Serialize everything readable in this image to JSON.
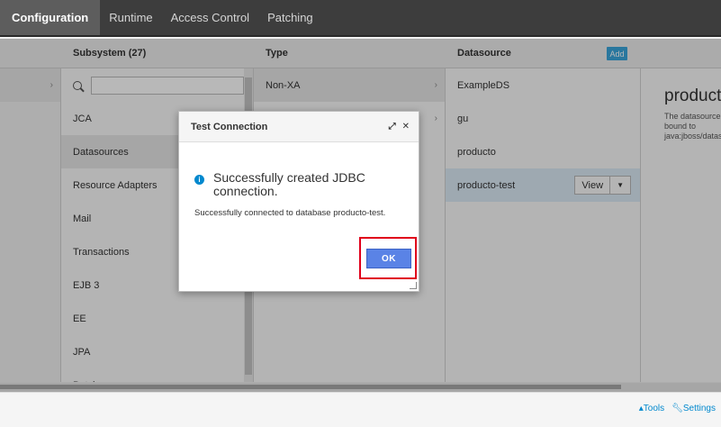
{
  "topnav": {
    "tabs": [
      "Configuration",
      "Runtime",
      "Access Control",
      "Patching"
    ]
  },
  "columns": {
    "subsystem": {
      "header": "Subsystem (27)",
      "items": [
        "JCA",
        "Datasources",
        "Resource Adapters",
        "Mail",
        "Transactions",
        "EJB 3",
        "EE",
        "JPA",
        "Batch"
      ]
    },
    "type": {
      "header": "Type",
      "items": [
        "Non-XA"
      ]
    },
    "datasource": {
      "header": "Datasource",
      "add_label": "Add",
      "items": [
        "ExampleDS",
        "gu",
        "producto",
        "producto-test"
      ],
      "view_label": "View"
    }
  },
  "detail": {
    "title": "producto-test",
    "description": "The datasource producto-test is bound to java:jboss/datasources/Datasource-"
  },
  "footer": {
    "tools": "Tools",
    "settings": "Settings"
  },
  "dialog": {
    "title": "Test Connection",
    "message": "Successfully created JDBC connection.",
    "sub": "Successfully connected to database producto-test.",
    "ok_label": "OK"
  }
}
